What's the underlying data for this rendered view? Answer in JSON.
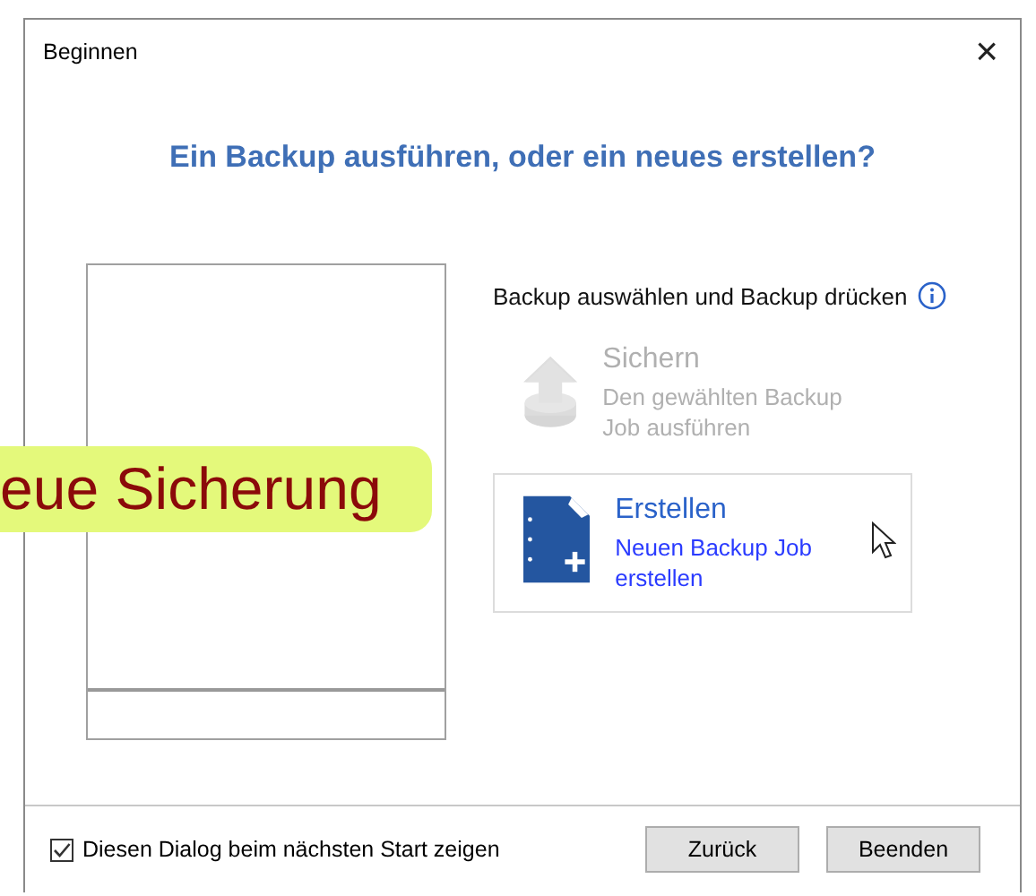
{
  "window": {
    "title": "Beginnen",
    "close": "×"
  },
  "heading": "Ein Backup ausführen, oder ein neues erstellen?",
  "callout": "eue Sicherung",
  "hint": "Backup auswählen und Backup drücken",
  "actions": [
    {
      "kind": "run",
      "title": "Sichern",
      "description": "Den gewählten Backup Job ausführen",
      "disabled": true,
      "hovered": false
    },
    {
      "kind": "create",
      "title": "Erstellen",
      "description": "Neuen Backup Job erstellen",
      "disabled": false,
      "hovered": true
    }
  ],
  "footer": {
    "checkbox": {
      "label": "Diesen Dialog beim nächsten Start zeigen",
      "checked": true
    },
    "buttons": [
      "Zurück",
      "Beenden"
    ]
  }
}
